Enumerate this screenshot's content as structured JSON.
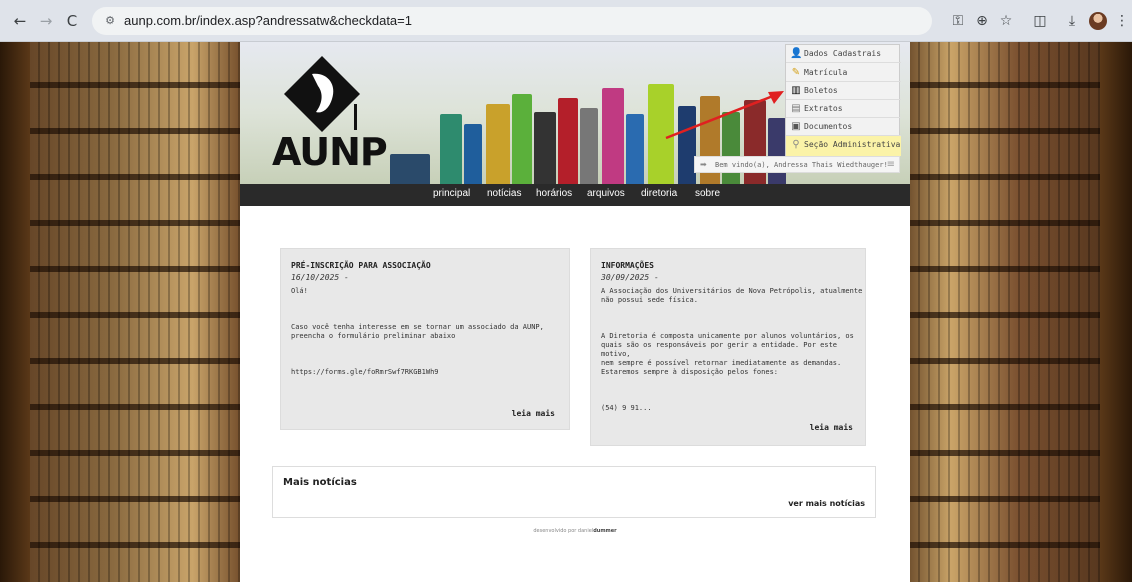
{
  "browser": {
    "url": "aunp.com.br/index.asp?andressatw&checkdata=1",
    "back_icon": "←",
    "forward_icon": "→",
    "reload_icon": "C",
    "tune_icon": "⚙",
    "icons": [
      "key-icon",
      "zoom-icon",
      "star-icon",
      "extension-icon",
      "download-icon",
      "profile-avatar",
      "menu-icon"
    ]
  },
  "site": {
    "logo_text": "AUNP",
    "nav": [
      "principal",
      "notícias",
      "horários",
      "arquivos",
      "diretoria",
      "sobre"
    ]
  },
  "user_menu": {
    "items": [
      {
        "label": "Dados Cadastrais",
        "icon": "user-icon"
      },
      {
        "label": "Matrícula",
        "icon": "pencil-icon"
      },
      {
        "label": "Boletos",
        "icon": "barcode-icon"
      },
      {
        "label": "Extratos",
        "icon": "document-icon"
      },
      {
        "label": "Documentos",
        "icon": "file-icon"
      },
      {
        "label": "Seção Administrativa",
        "icon": "admin-icon"
      }
    ],
    "welcome": "Bem vindo(a), Andressa Thais Wiedthauger!"
  },
  "cards": [
    {
      "title": "PRÉ-INSCRIÇÃO PARA ASSOCIAÇÃO",
      "date": "16/10/2025 -",
      "body": "Olá!\n\n\n\nCaso você tenha interesse em se tornar um associado da AUNP,\npreencha o formulário preliminar abaixo\n\n\n\nhttps://forms.gle/foRmrSwf7RKGB1Wh9",
      "more": "leia mais"
    },
    {
      "title": "INFORMAÇÕES",
      "date": "30/09/2025 -",
      "body": "A Associação dos Universitários de Nova Petrópolis, atualmente\nnão possui sede física.\n\n\n\nA Diretoria é composta unicamente por alunos voluntários, os\nquais são os responsáveis por gerir a entidade. Por este motivo,\nnem sempre é possível retornar imediatamente as demandas.\nEstaremos sempre à disposição pelos fones:\n\n\n\n(54) 9 91...",
      "more": "leia mais"
    }
  ],
  "more_news": {
    "title": "Mais notícias",
    "link": "ver mais notícias"
  },
  "footer": {
    "prefix": "desenvolvido por daniel",
    "author": "dummer"
  },
  "colors": {
    "navbar": "#2a2a2a",
    "card": "#e8e8e8",
    "admin_highlight": "#fbf3a8",
    "arrow": "#e02020"
  }
}
